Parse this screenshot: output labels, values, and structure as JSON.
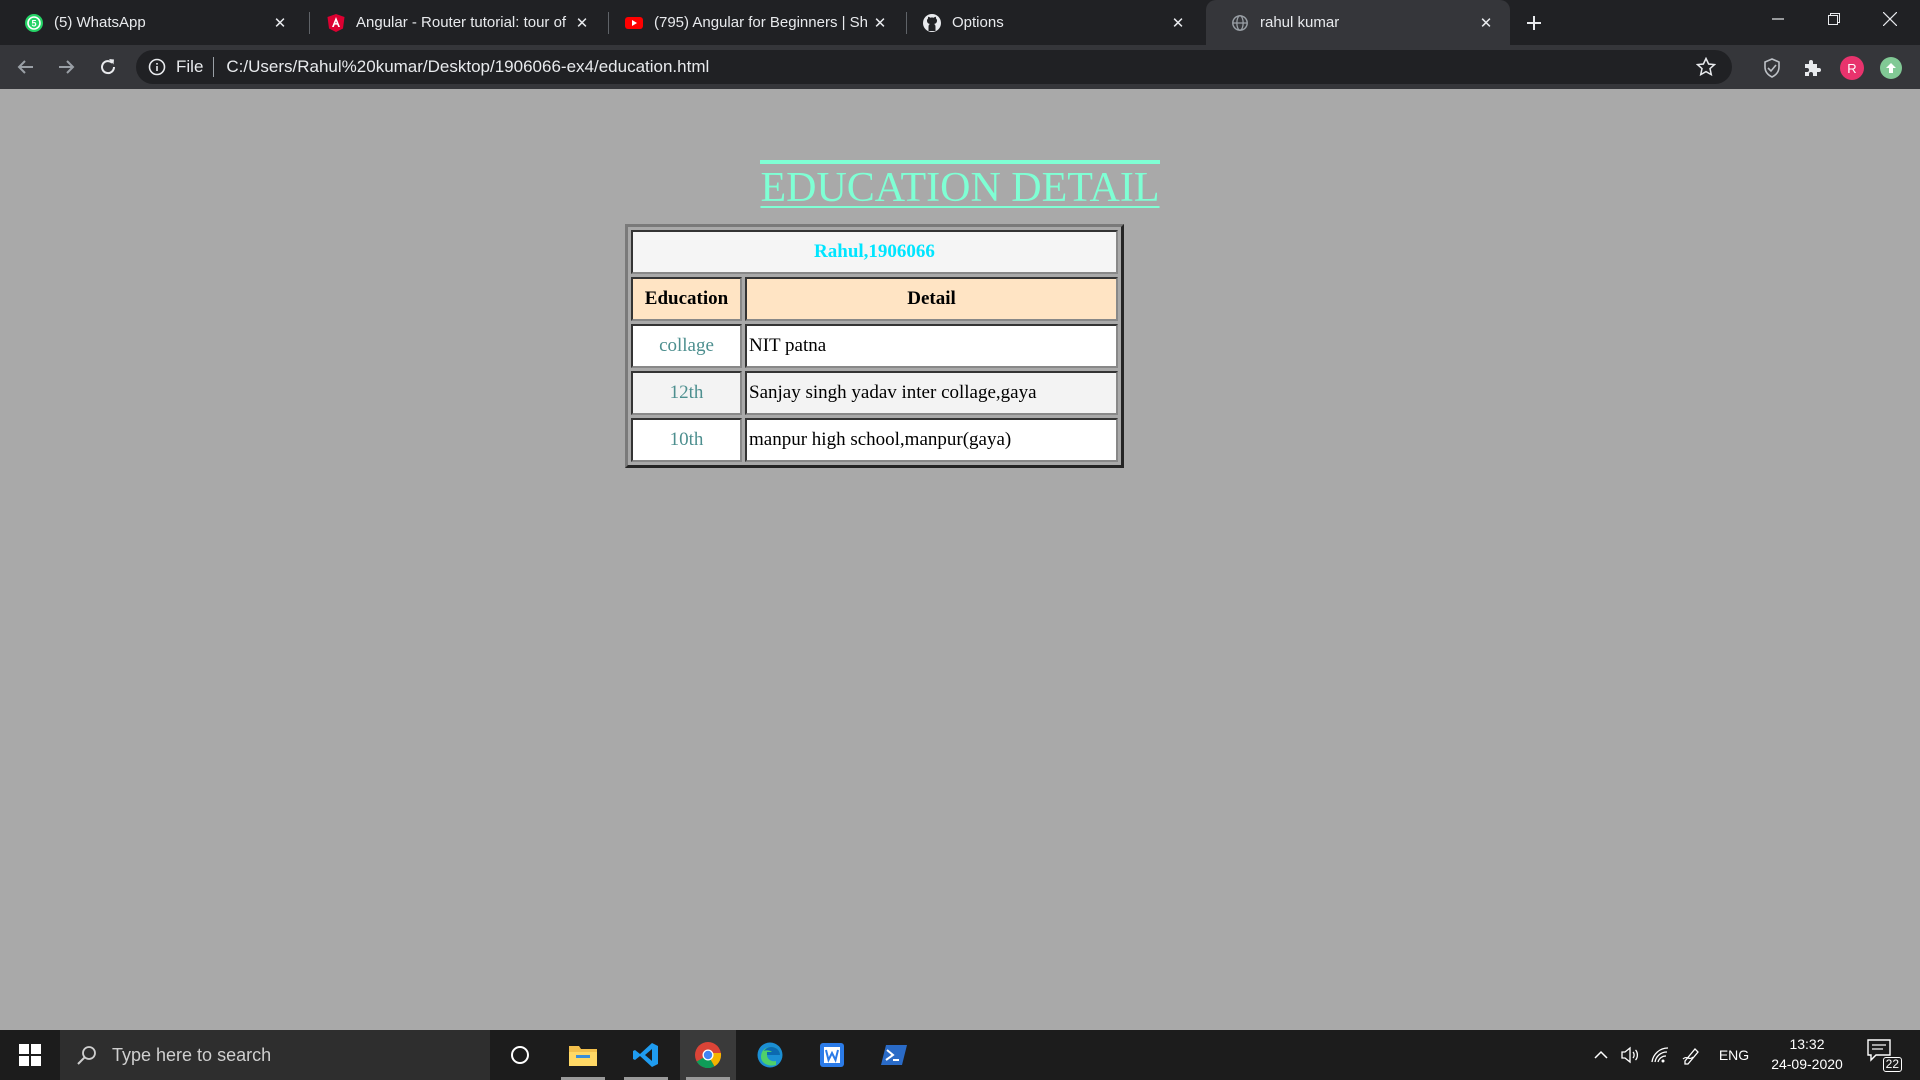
{
  "browser": {
    "tabs": [
      {
        "title": "(5) WhatsApp",
        "icon": "whatsapp-icon"
      },
      {
        "title": "Angular - Router tutorial: tour of",
        "icon": "angular-icon"
      },
      {
        "title": "(795) Angular for Beginners | Sha",
        "icon": "youtube-icon"
      },
      {
        "title": "Options",
        "icon": "github-icon"
      },
      {
        "title": "rahul kumar",
        "icon": "globe-icon"
      }
    ],
    "active_tab": "rahul kumar",
    "address": {
      "scheme": "File",
      "url": "C:/Users/Rahul%20kumar/Desktop/1906066-ex4/education.html"
    },
    "profile_initial": "R"
  },
  "page": {
    "title": "EDUCATION DETAIL",
    "table": {
      "caption": "Rahul,1906066",
      "headers": [
        "Education",
        "Detail"
      ],
      "rows": [
        {
          "level": "collage",
          "institution": "NIT patna"
        },
        {
          "level": "12th",
          "institution": "Sanjay singh yadav inter collage,gaya"
        },
        {
          "level": "10th",
          "institution": "manpur high school,manpur(gaya)"
        }
      ]
    }
  },
  "taskbar": {
    "search_placeholder": "Type here to search",
    "language": "ENG",
    "time": "13:32",
    "date": "24-09-2020",
    "notification_count": "22"
  },
  "colors": {
    "page_background": "#a9a9a9",
    "title": "#7fffd4",
    "caption": "#00e5ff",
    "header_background": "#ffe4c4",
    "level_text": "#4d8f8f"
  }
}
